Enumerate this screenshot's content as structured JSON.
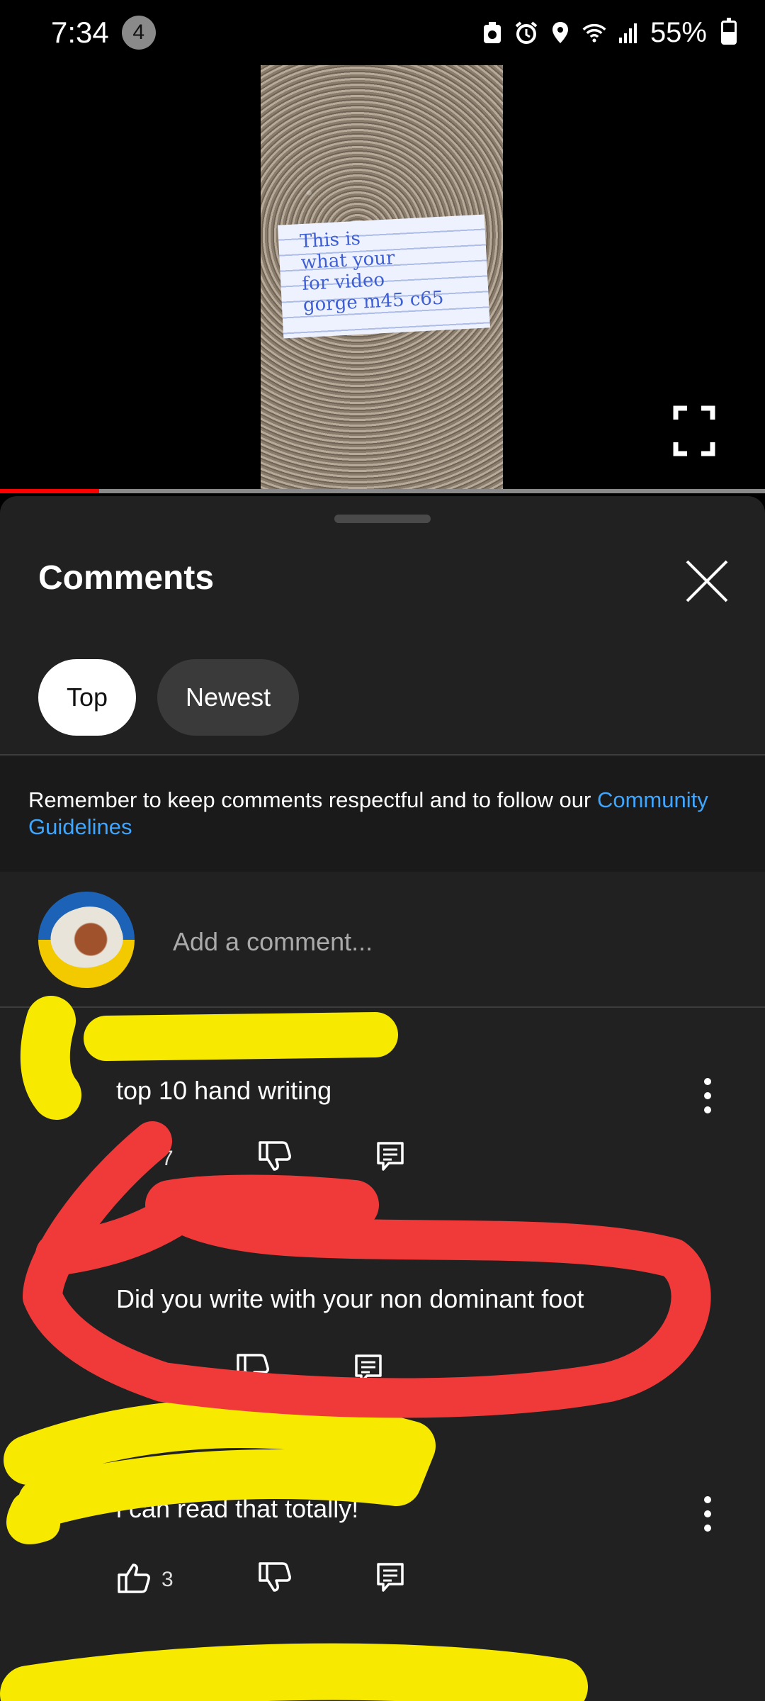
{
  "status_bar": {
    "time": "7:34",
    "notification_count": "4",
    "battery_percent": "55%",
    "battery_level": 0.55
  },
  "video": {
    "note_lines": [
      "This is",
      "what your",
      "for video",
      "gorge m45 c65"
    ],
    "progress": 0.13
  },
  "comments_sheet": {
    "title": "Comments",
    "chips": [
      {
        "label": "Top",
        "active": true
      },
      {
        "label": "Newest",
        "active": false
      }
    ],
    "guidelines_text": "Remember to keep comments respectful and to follow our ",
    "guidelines_link": "Community Guidelines",
    "add_comment_placeholder": "Add a comment...",
    "comments": [
      {
        "text": "top 10 hand writing",
        "likes": "7"
      },
      {
        "text": "Did you write with your non dominant  foot",
        "likes": ""
      },
      {
        "text": "i can read that totally!",
        "likes": "3"
      }
    ]
  },
  "colors": {
    "accent_red": "#ff0000",
    "link_blue": "#3ea6ff",
    "sheet_bg": "#212121",
    "highlighter_yellow": "#f7ea00",
    "marker_red": "#f03a3a"
  }
}
